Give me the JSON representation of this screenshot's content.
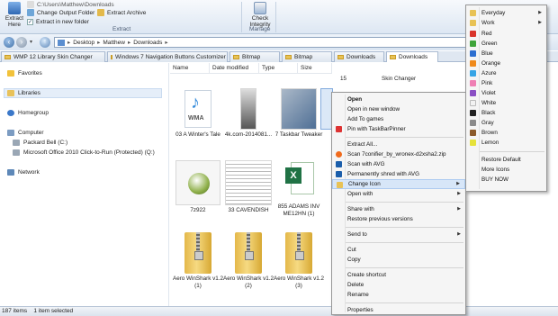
{
  "ribbon": {
    "extract_here": "Extract Here",
    "path_text": "C:\\Users\\Matthew\\Downloads",
    "change_output": "Change Output Folder",
    "extract_archive": "Extract Archive",
    "extract_new_folder": "Extract in new folder",
    "extract_group": "Extract",
    "check_integrity": "Check Integrity",
    "manage_group": "Manage"
  },
  "address": {
    "crumbs": [
      "Desktop",
      "Matthew",
      "Downloads"
    ]
  },
  "tabs": [
    "WMP 12 Library Skin Changer",
    "Windows 7 Navigation Buttons Customizer",
    "Bitmap",
    "Bitmap",
    "Downloads",
    "Downloads"
  ],
  "navpane": {
    "favorites": "Favorites",
    "libraries": "Libraries",
    "homegroup": "Homegroup",
    "computer": "Computer",
    "drive_c": "Packard Bell (C:)",
    "drive_q": "Microsoft Office 2010 Click-to-Run (Protected) (Q:)",
    "network": "Network"
  },
  "columns": [
    "Name",
    "Date modified",
    "Type",
    "Size"
  ],
  "files": {
    "f1": "03 A Winter's Tale",
    "f2": "4k.com-2014081...",
    "f3": "7 Taskbar Tweaker",
    "f4": "7z922",
    "f5": "33 CAVENDISH",
    "f6": "855 ADAMS INV ME12HN (1)",
    "f7": "Aero WinShark v1.2 (1)",
    "f8": "Aero WinShark v1.2 (2)",
    "f9": "Aero WinShark v1.2 (3)",
    "wma_label": "WMA",
    "partial_15": "15",
    "partial_skin": "Skin Changer"
  },
  "context_menu": {
    "items": [
      "Open",
      "Open in new window",
      "Add To games",
      "Pin with TaskBarPinner",
      "Extract All...",
      "Scan 7conifier_by_wronex-d2xsha2.zip",
      "Scan with AVG",
      "Permanently shred with AVG",
      "Change Icon",
      "Open with",
      "Share with",
      "Restore previous versions",
      "Send to",
      "Cut",
      "Copy",
      "Create shortcut",
      "Delete",
      "Rename",
      "Properties"
    ]
  },
  "icon_menu": {
    "items": [
      "Everyday",
      "Work",
      "Red",
      "Green",
      "Blue",
      "Orange",
      "Azure",
      "Pink",
      "Violet",
      "White",
      "Black",
      "Gray",
      "Brown",
      "Lemon",
      "Restore Default",
      "More Icons",
      "BUY NOW"
    ],
    "colors": {
      "Red": "#d9342b",
      "Green": "#3fa43a",
      "Blue": "#2d6fd0",
      "Orange": "#f08a1c",
      "Azure": "#37a5e6",
      "Pink": "#ef7fb4",
      "Violet": "#8a4fc4",
      "White": "#f2f2f2",
      "Black": "#222222",
      "Gray": "#8a8a8a",
      "Brown": "#8b5a2b",
      "Lemon": "#e6e23a"
    }
  },
  "status": {
    "item_count": "187 items",
    "selected": "1 item selected"
  }
}
